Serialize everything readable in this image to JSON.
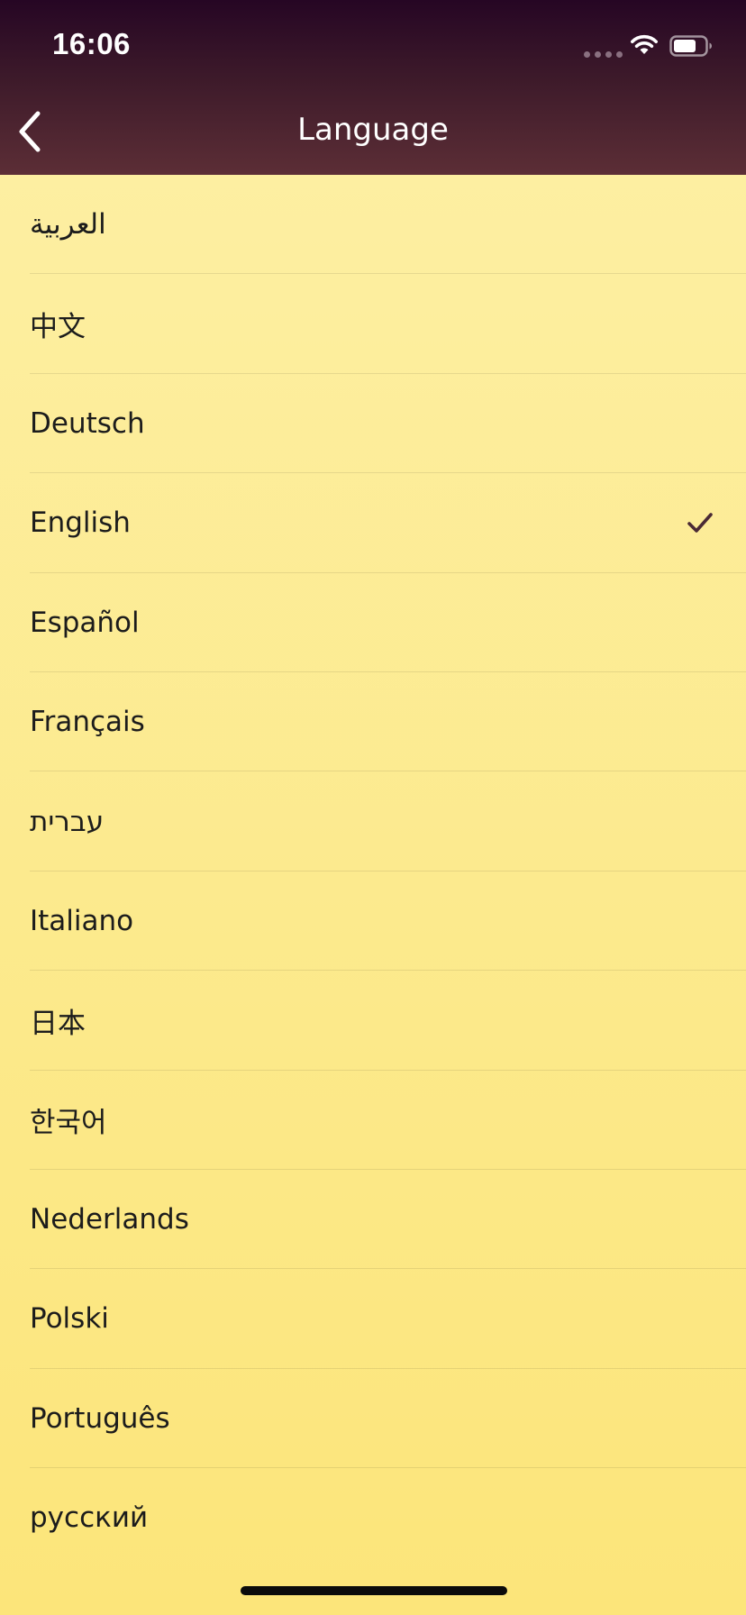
{
  "status_bar": {
    "time": "16:06"
  },
  "nav": {
    "title": "Language",
    "back_icon": "chevron-left-icon"
  },
  "languages": [
    {
      "label": "العربية",
      "selected": false
    },
    {
      "label": "中文",
      "selected": false
    },
    {
      "label": "Deutsch",
      "selected": false
    },
    {
      "label": "English",
      "selected": true
    },
    {
      "label": "Español",
      "selected": false
    },
    {
      "label": "Français",
      "selected": false
    },
    {
      "label": "עברית",
      "selected": false
    },
    {
      "label": "Italiano",
      "selected": false
    },
    {
      "label": "日本",
      "selected": false
    },
    {
      "label": "한국어",
      "selected": false
    },
    {
      "label": "Nederlands",
      "selected": false
    },
    {
      "label": "Polski",
      "selected": false
    },
    {
      "label": "Português",
      "selected": false
    },
    {
      "label": "русский",
      "selected": false
    }
  ],
  "colors": {
    "header_top": "#260624",
    "header_bottom": "#5c2e36",
    "background_top": "#fdf0a6",
    "background_bottom": "#fce57a",
    "checkmark": "#4a2a35"
  }
}
